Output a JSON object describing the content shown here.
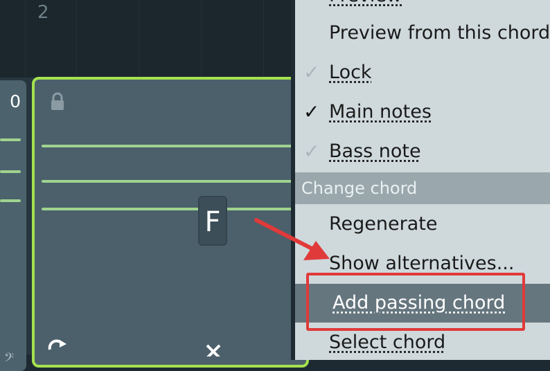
{
  "timeline": {
    "bar_number": "2"
  },
  "chord_cards": {
    "previous": {
      "number": "0"
    },
    "current": {
      "chord_name": "F"
    }
  },
  "context_menu": {
    "items_top": [
      {
        "label": "Preview",
        "checked": false
      },
      {
        "label": "Preview from this chord",
        "checked": false
      },
      {
        "label": "Lock",
        "check": "faded"
      },
      {
        "label": "Main notes",
        "check": "checked"
      },
      {
        "label": "Bass note",
        "check": "faded"
      }
    ],
    "section_header": "Change chord",
    "items_change": [
      {
        "label": "Regenerate"
      },
      {
        "label": "Show alternatives..."
      },
      {
        "label": "Add passing chord",
        "highlighted": true
      },
      {
        "label": "Select chord"
      }
    ]
  },
  "annotation": {
    "box_color": "#e03a3a",
    "arrow_color": "#e03a3a",
    "target": "Add passing chord"
  },
  "colors": {
    "selection_border": "#a4e14f",
    "note_line": "#9fd38f",
    "menu_background": "#cfd9dc",
    "menu_highlight": "#66767e"
  }
}
